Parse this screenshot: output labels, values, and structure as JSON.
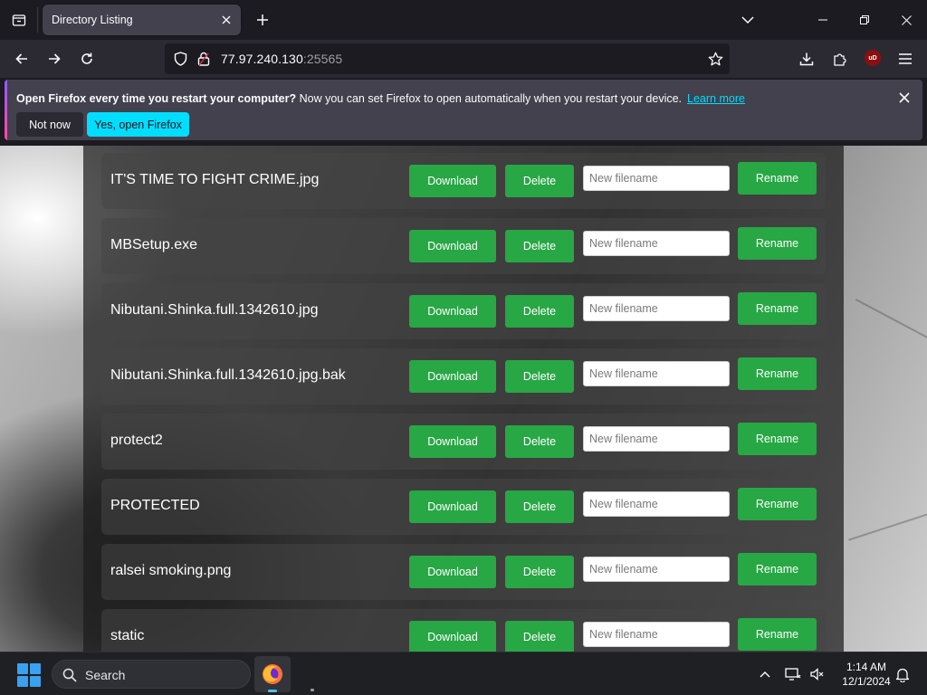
{
  "browser": {
    "tab_title": "Directory Listing",
    "url_host": "77.97.240.130",
    "url_port": ":25565",
    "ublock_label": "uD"
  },
  "notification": {
    "bold_text": "Open Firefox every time you restart your computer?",
    "text": " Now you can set Firefox to open automatically when you restart your device.",
    "link": "Learn more",
    "not_now": "Not now",
    "yes_open": "Yes, open Firefox"
  },
  "files": [
    {
      "name": "IT'S TIME TO FIGHT CRIME.jpg"
    },
    {
      "name": "MBSetup.exe"
    },
    {
      "name": "Nibutani.Shinka.full.1342610.jpg"
    },
    {
      "name": "Nibutani.Shinka.full.1342610.jpg.bak"
    },
    {
      "name": "protect2"
    },
    {
      "name": "PROTECTED"
    },
    {
      "name": "ralsei smoking.png"
    },
    {
      "name": "static"
    }
  ],
  "row_actions": {
    "download": "Download",
    "delete": "Delete",
    "rename_placeholder": "New filename",
    "rename": "Rename"
  },
  "taskbar": {
    "search_label": "Search",
    "time": "1:14 AM",
    "date": "12/1/2024"
  },
  "colors": {
    "accent_green": "#28a745",
    "firefox_cyan": "#00ddff",
    "browser_dark": "#1c1b22"
  },
  "icons": [
    "tab-list-icon",
    "close-icon",
    "plus-icon",
    "chevron-down-icon",
    "minimize-icon",
    "maximize-icon",
    "back-icon",
    "forward-icon",
    "reload-icon",
    "shield-icon",
    "lock-icon",
    "star-icon",
    "download-icon",
    "extensions-icon",
    "menu-icon",
    "windows-logo-icon",
    "search-icon",
    "firefox-icon",
    "chevron-up-icon",
    "network-icon",
    "volume-icon",
    "bell-icon"
  ]
}
